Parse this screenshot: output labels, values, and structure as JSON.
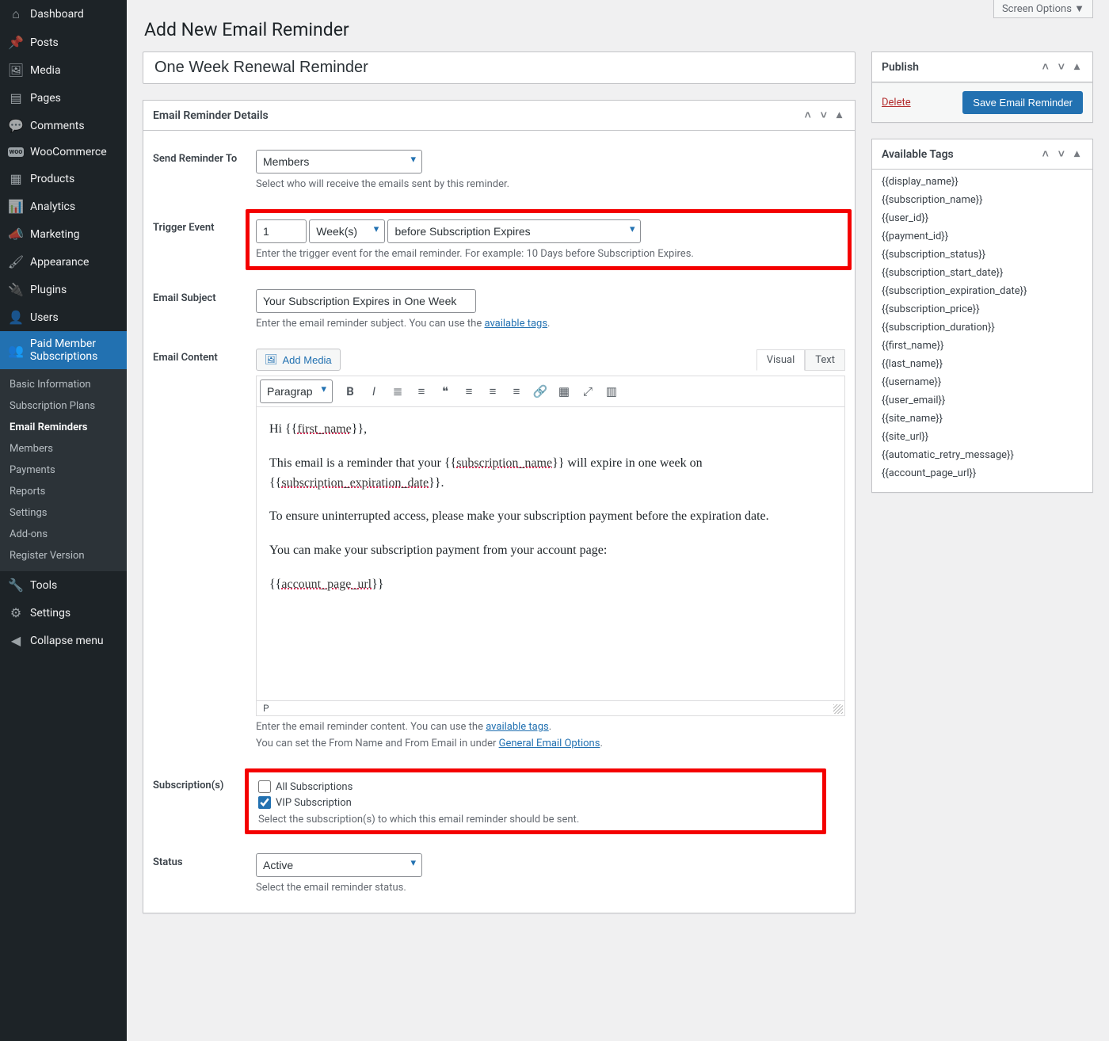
{
  "screen_options": "Screen Options  ▼",
  "page_title": "Add New Email Reminder",
  "title_value": "One Week Renewal Reminder",
  "sidebar": {
    "items": [
      {
        "icon": "⌂",
        "label": "Dashboard"
      },
      {
        "icon": "✎",
        "label": "Posts"
      },
      {
        "icon": "♫",
        "label": "Media"
      },
      {
        "icon": "▤",
        "label": "Pages"
      },
      {
        "icon": "💬",
        "label": "Comments"
      },
      {
        "icon": "woo",
        "label": "WooCommerce"
      },
      {
        "icon": "▦",
        "label": "Products"
      },
      {
        "icon": "▮",
        "label": "Analytics"
      },
      {
        "icon": "📣",
        "label": "Marketing"
      },
      {
        "icon": "✐",
        "label": "Appearance"
      },
      {
        "icon": "◨",
        "label": "Plugins"
      },
      {
        "icon": "👤",
        "label": "Users"
      },
      {
        "icon": "👥",
        "label": "Paid Member Subscriptions"
      },
      {
        "icon": "🔧",
        "label": "Tools"
      },
      {
        "icon": "⚙",
        "label": "Settings"
      },
      {
        "icon": "◀",
        "label": "Collapse menu"
      }
    ],
    "sub": [
      "Basic Information",
      "Subscription Plans",
      "Email Reminders",
      "Members",
      "Payments",
      "Reports",
      "Settings",
      "Add-ons",
      "Register Version"
    ]
  },
  "details": {
    "header": "Email Reminder Details",
    "send_to": {
      "label": "Send Reminder To",
      "value": "Members",
      "help": "Select who will receive the emails sent by this reminder."
    },
    "trigger": {
      "label": "Trigger Event",
      "num": "1",
      "unit": "Week(s)",
      "when": "before Subscription Expires",
      "help": "Enter the trigger event for the email reminder. For example: 10 Days before Subscription Expires."
    },
    "subject": {
      "label": "Email Subject",
      "value": "Your Subscription Expires in One Week",
      "help_pre": "Enter the email reminder subject. You can use the ",
      "help_link": "available tags",
      "help_post": "."
    },
    "content": {
      "label": "Email Content",
      "add_media": "Add Media",
      "tabs": {
        "visual": "Visual",
        "text": "Text"
      },
      "format": "Paragraph",
      "status": "P",
      "help1_pre": "Enter the email reminder content. You can use the ",
      "help1_link": "available tags",
      "help1_post": ".",
      "help2_pre": "You can set the From Name and From Email in under ",
      "help2_link": "General Email Options",
      "help2_post": ".",
      "body": {
        "l1a": "Hi {{",
        "l1b": "first_name",
        "l1c": "}},",
        "l2a": "This email is a reminder that your {{",
        "l2b": "subscription_name",
        "l2c": "}} will expire in one week on {{",
        "l2d": "subscription_expiration_date",
        "l2e": "}}.",
        "l3": "To ensure uninterrupted access, please make your subscription payment before the expiration date.",
        "l4": "You can make your subscription payment from your account page:",
        "l5a": "{{",
        "l5b": "account_page_url",
        "l5c": "}}"
      }
    },
    "subs": {
      "label": "Subscription(s)",
      "opt1": "All Subscriptions",
      "opt2": "VIP Subscription",
      "help": "Select the subscription(s) to which this email reminder should be sent."
    },
    "status": {
      "label": "Status",
      "value": "Active",
      "help": "Select the email reminder status."
    }
  },
  "publish": {
    "header": "Publish",
    "delete": "Delete",
    "save": "Save Email Reminder"
  },
  "tags": {
    "header": "Available Tags",
    "items": [
      "{{display_name}}",
      "{{subscription_name}}",
      "{{user_id}}",
      "{{payment_id}}",
      "{{subscription_status}}",
      "{{subscription_start_date}}",
      "{{subscription_expiration_date}}",
      "{{subscription_price}}",
      "{{subscription_duration}}",
      "{{first_name}}",
      "{{last_name}}",
      "{{username}}",
      "{{user_email}}",
      "{{site_name}}",
      "{{site_url}}",
      "{{automatic_retry_message}}",
      "{{account_page_url}}"
    ]
  }
}
